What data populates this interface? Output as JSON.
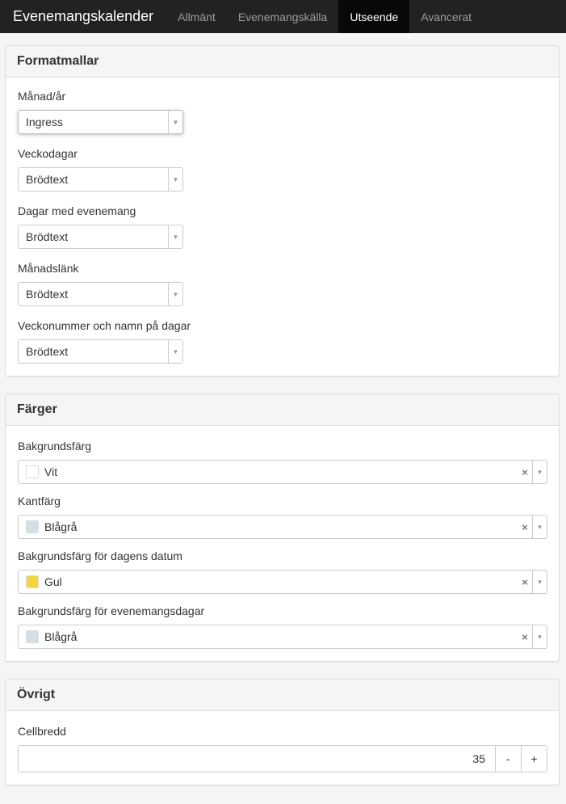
{
  "navbar": {
    "brand": "Evenemangskalender",
    "tabs": [
      {
        "label": "Allmänt"
      },
      {
        "label": "Evenemangskälla"
      },
      {
        "label": "Utseende"
      },
      {
        "label": "Avancerat"
      }
    ]
  },
  "formatmallar": {
    "title": "Formatmallar",
    "fields": [
      {
        "label": "Månad/år",
        "value": "Ingress"
      },
      {
        "label": "Veckodagar",
        "value": "Brödtext"
      },
      {
        "label": "Dagar med evenemang",
        "value": "Brödtext"
      },
      {
        "label": "Månadslänk",
        "value": "Brödtext"
      },
      {
        "label": "Veckonummer och namn på dagar",
        "value": "Brödtext"
      }
    ]
  },
  "farger": {
    "title": "Färger",
    "fields": [
      {
        "label": "Bakgrundsfärg",
        "value": "Vit",
        "swatch": "#ffffff"
      },
      {
        "label": "Kantfärg",
        "value": "Blågrå",
        "swatch": "#d3e0e3"
      },
      {
        "label": "Bakgrundsfärg för dagens datum",
        "value": "Gul",
        "swatch": "#f7d43b"
      },
      {
        "label": "Bakgrundsfärg för evenemangsdagar",
        "value": "Blågrå",
        "swatch": "#d3e0e3"
      }
    ],
    "clear_symbol": "×",
    "arrow_symbol": "▼"
  },
  "ovrigt": {
    "title": "Övrigt",
    "cellbredd": {
      "label": "Cellbredd",
      "value": "35",
      "minus": "-",
      "plus": "+"
    }
  }
}
